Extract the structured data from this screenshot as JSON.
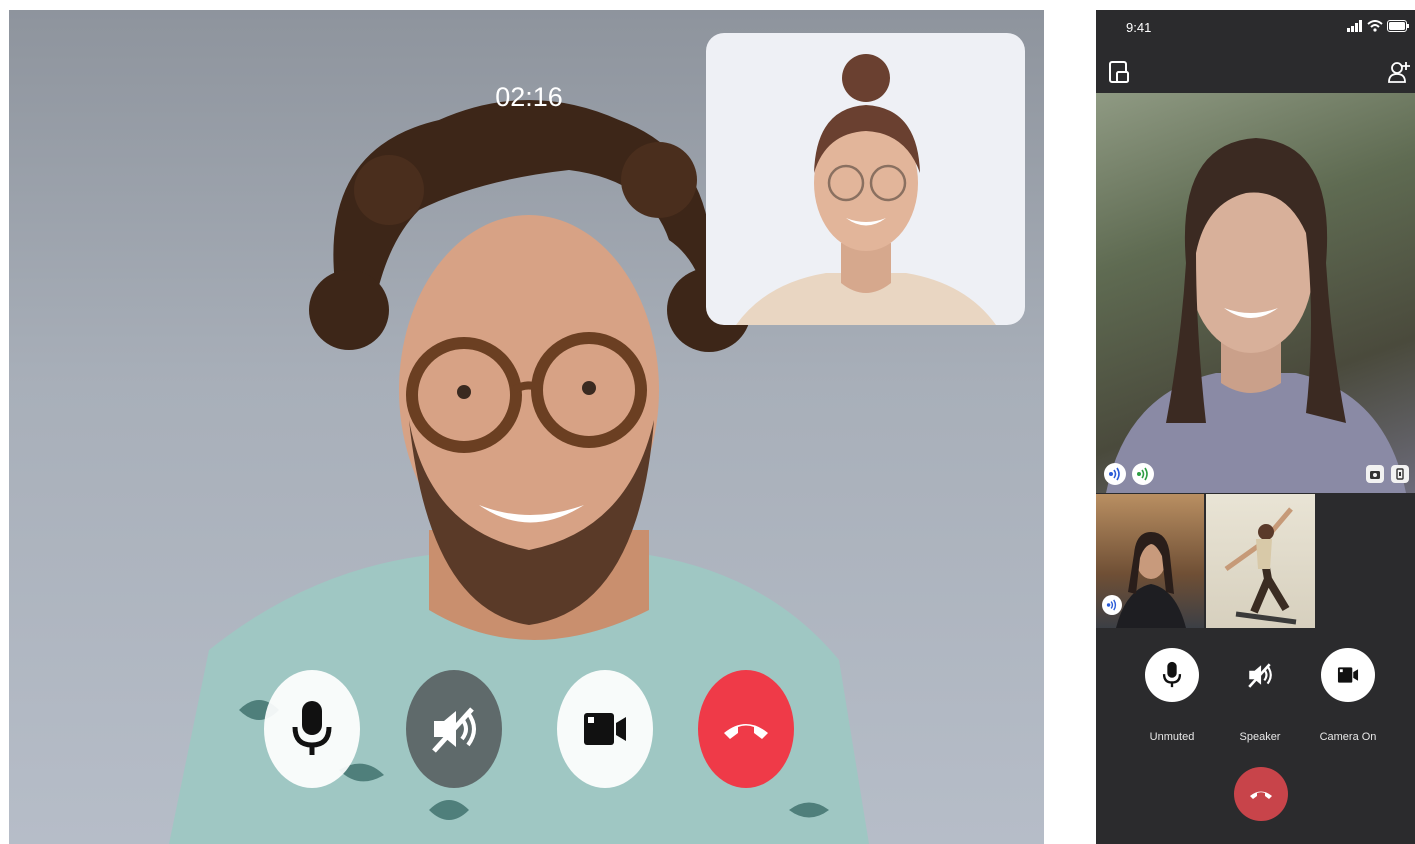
{
  "desktop": {
    "timer": "02:16",
    "controls": {
      "mic_icon": "microphone-icon",
      "speaker_icon": "speaker-muted-icon",
      "camera_icon": "video-camera-icon",
      "end_icon": "phone-hangup-icon"
    },
    "colors": {
      "end_call": "#ef3a48"
    }
  },
  "mobile": {
    "status_time": "9:41",
    "controls": {
      "mic_label": "Unmuted",
      "speaker_label": "Speaker",
      "camera_label": "Camera On"
    },
    "colors": {
      "end_call": "#c8444a",
      "background": "#2b2b2d"
    }
  }
}
